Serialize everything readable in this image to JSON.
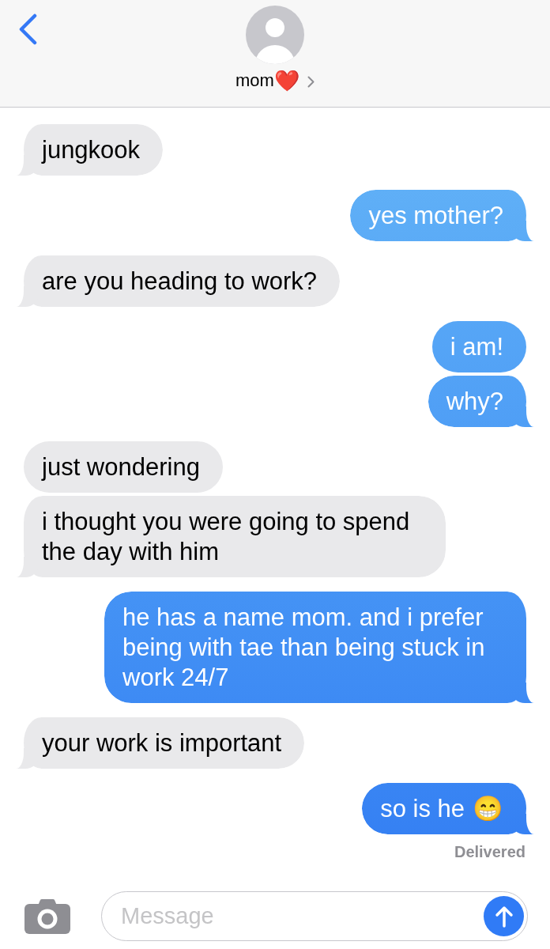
{
  "contact": {
    "name": "mom",
    "emoji": "❤️"
  },
  "messages": [
    {
      "kind": "received",
      "text": "jungkook"
    },
    {
      "kind": "sent",
      "text": "yes mother?"
    },
    {
      "kind": "received",
      "text": "are you heading to work?"
    },
    {
      "kind": "sent",
      "text": "i am!"
    },
    {
      "kind": "sent",
      "text": "why?"
    },
    {
      "kind": "received",
      "text": "just wondering"
    },
    {
      "kind": "received",
      "text": "i thought you were going to spend the day with him"
    },
    {
      "kind": "sent",
      "text": "he has a name mom. and i prefer being with tae than being stuck in work 24/7"
    },
    {
      "kind": "received",
      "text": "your work is important"
    },
    {
      "kind": "sent",
      "text": "so is he",
      "emoji": "😁"
    }
  ],
  "receipt": "Delivered",
  "composer": {
    "placeholder": "Message"
  }
}
